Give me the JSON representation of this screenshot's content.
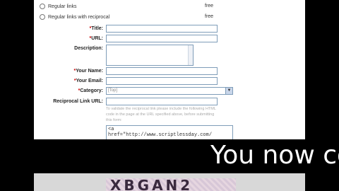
{
  "link_options": [
    {
      "label": "Regular links",
      "price": "free"
    },
    {
      "label": "Regular links with reciprocal",
      "price": "free"
    }
  ],
  "form": {
    "title_label": "Title:",
    "url_label": "URL:",
    "description_label": "Description:",
    "name_label": "Your Name:",
    "email_label": "Your Email:",
    "category_label": "Category:",
    "category_value": "[Top]",
    "reciprocal_label": "Reciprocal Link URL:",
    "required_mark": "*",
    "help_text": "To validate the reciprocal link please include the following HTML code in the page at the URL specified above, before submitting this form:",
    "code_text": "<a\nhref=\"http://www.scriptlessday.com/"
  },
  "captcha_text": "XBGAN2",
  "caption": "You now co"
}
